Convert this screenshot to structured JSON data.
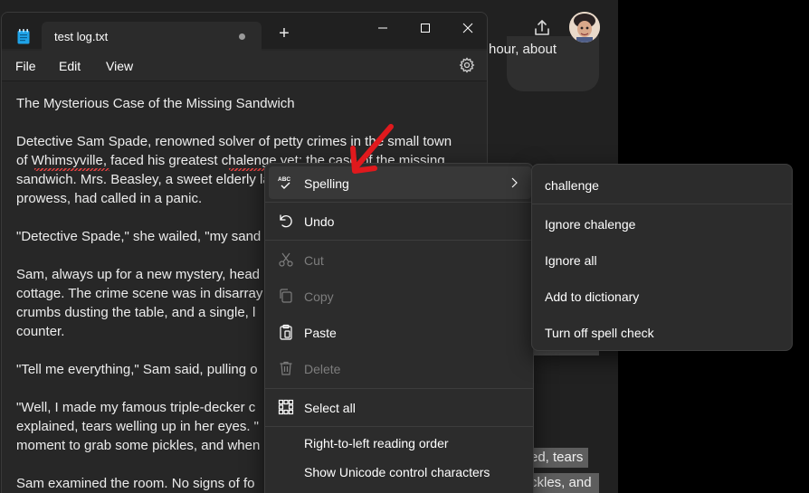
{
  "background_app": {
    "bubble_text": "hour, about",
    "lines": [
      {
        "text": "ed, tears",
        "highlight": true
      },
      {
        "text": "ckles, and",
        "highlight": true
      }
    ]
  },
  "notepad": {
    "tab_title": "test log.txt",
    "new_tab_label": "+",
    "menu": {
      "file": "File",
      "edit": "Edit",
      "view": "View"
    },
    "lines": [
      "The Mysterious Case of the Missing Sandwich",
      "",
      "Detective Sam Spade, renowned solver of petty crimes in the small town",
      "of Whimsyville, faced his greatest chalenge yet: the case of the missing",
      "sandwich. Mrs. Beasley, a sweet elderly la",
      "prowess, had called in a panic.",
      "",
      "\"Detective Spade,\" she wailed, \"my sand",
      "",
      "Sam, always up for a new mystery, head",
      "cottage. The crime scene was in disarray",
      "crumbs dusting the table, and a single, l",
      "counter.",
      "",
      "\"Tell me everything,\" Sam said, pulling o",
      "",
      "\"Well, I made my famous triple-decker c",
      "explained, tears welling up in her eyes. \"",
      "moment to grab some pickles, and when",
      "",
      "Sam examined the room. No signs of fo"
    ]
  },
  "context_menu": {
    "items": [
      {
        "id": "spelling",
        "label": "Spelling",
        "icon": "spell-check-icon",
        "disabled": false,
        "submenu": true
      },
      {
        "id": "undo",
        "label": "Undo",
        "icon": "undo-icon",
        "disabled": false
      },
      {
        "id": "cut",
        "label": "Cut",
        "icon": "scissors-icon",
        "disabled": true
      },
      {
        "id": "copy",
        "label": "Copy",
        "icon": "copy-icon",
        "disabled": true
      },
      {
        "id": "paste",
        "label": "Paste",
        "icon": "clipboard-icon",
        "disabled": false
      },
      {
        "id": "delete",
        "label": "Delete",
        "icon": "trash-icon",
        "disabled": true
      },
      {
        "id": "select_all",
        "label": "Select all",
        "icon": "select-all-icon",
        "disabled": false
      },
      {
        "id": "rtl",
        "label": "Right-to-left reading order",
        "disabled": false
      },
      {
        "id": "unicode",
        "label": "Show Unicode control characters",
        "disabled": false
      }
    ]
  },
  "spelling_submenu": {
    "suggestion": "challenge",
    "ignore": "Ignore chalenge",
    "ignore_all": "Ignore all",
    "add_dictionary": "Add to dictionary",
    "turn_off": "Turn off spell check"
  },
  "colors": {
    "accent_arrow": "#e0191d",
    "squiggle": "#e04040",
    "menu_bg": "#2c2c2c",
    "editor_bg": "#272727"
  }
}
